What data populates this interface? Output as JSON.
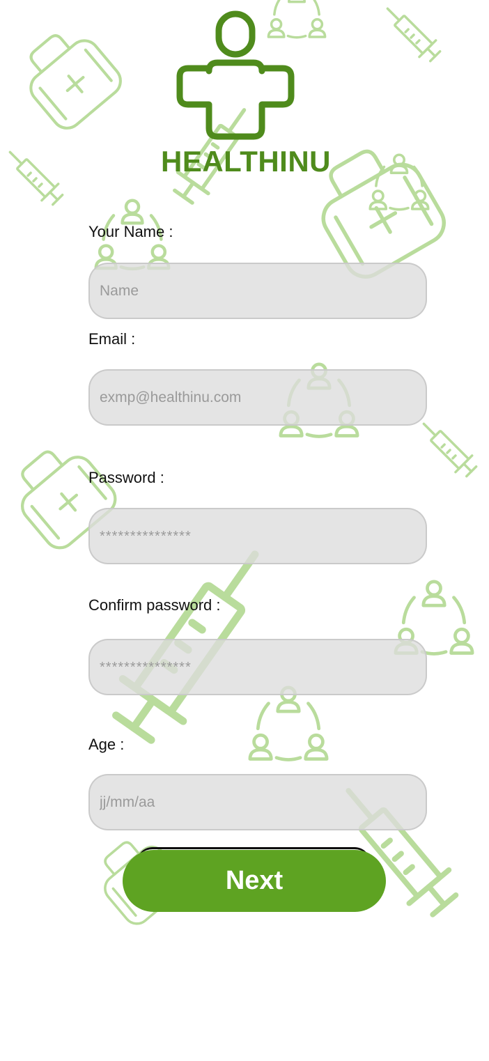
{
  "brand": {
    "name": "HEALTHINU",
    "logo_icon": "medical-cross-person-icon",
    "color": "#4f8b1c"
  },
  "form": {
    "name": {
      "label": "Your Name :",
      "placeholder": "Name"
    },
    "email": {
      "label": "Email :",
      "placeholder": "exmp@healthinu.com"
    },
    "password": {
      "label": "Password :",
      "placeholder": "***************"
    },
    "confirm_password": {
      "label": "Confirm password :",
      "placeholder": "***************"
    },
    "age": {
      "label": "Age :",
      "placeholder": "jj/mm/aa"
    }
  },
  "actions": {
    "next_label": "Next",
    "next_color": "#5ea322"
  },
  "background": {
    "pattern_color": "#b7dc9a",
    "icons": [
      "first-aid-kit-icon",
      "syringe-icon",
      "people-network-icon"
    ]
  }
}
